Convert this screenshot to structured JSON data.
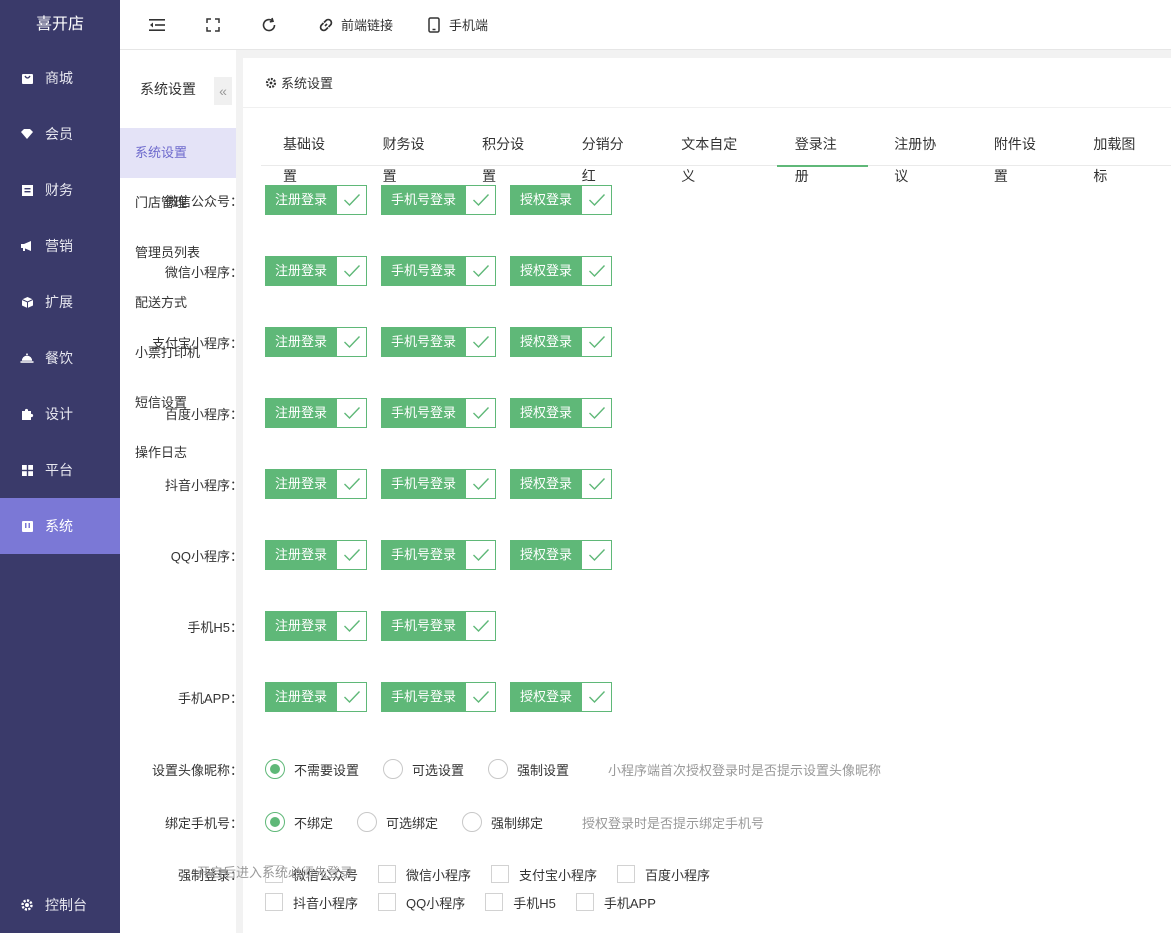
{
  "sidebar": {
    "logo": "喜开店",
    "items": [
      {
        "label": "商城",
        "icon": "shop-icon"
      },
      {
        "label": "会员",
        "icon": "member-icon"
      },
      {
        "label": "财务",
        "icon": "finance-icon"
      },
      {
        "label": "营销",
        "icon": "megaphone-icon"
      },
      {
        "label": "扩展",
        "icon": "cube-icon"
      },
      {
        "label": "餐饮",
        "icon": "dish-icon"
      },
      {
        "label": "设计",
        "icon": "puzzle-icon"
      },
      {
        "label": "平台",
        "icon": "grid-icon"
      },
      {
        "label": "系统",
        "icon": "system-icon"
      }
    ],
    "active_index": 8,
    "bottom": {
      "label": "控制台",
      "icon": "gear-icon"
    }
  },
  "header": {
    "menu_icon": "menu-fold-icon",
    "fullscreen_icon": "fullscreen-icon",
    "refresh_icon": "refresh-icon",
    "frontend_link": "前端链接",
    "mobile": "手机端"
  },
  "subnav": {
    "title": "系统设置",
    "collapse_glyph": "«",
    "items": [
      "系统设置",
      "门店管理",
      "管理员列表",
      "配送方式",
      "小票打印机",
      "短信设置",
      "操作日志"
    ],
    "active_index": 0
  },
  "panel": {
    "title": "系统设置",
    "tabs": [
      "基础设置",
      "财务设置",
      "积分设置",
      "分销分红",
      "文本自定义",
      "登录注册",
      "注册协议",
      "附件设置",
      "加载图标"
    ],
    "active_tab": 5
  },
  "login_rows": [
    {
      "label": "微信公众号：",
      "options": [
        "注册登录",
        "手机号登录",
        "授权登录"
      ]
    },
    {
      "label": "微信小程序：",
      "options": [
        "注册登录",
        "手机号登录",
        "授权登录"
      ]
    },
    {
      "label": "支付宝小程序：",
      "options": [
        "注册登录",
        "手机号登录",
        "授权登录"
      ]
    },
    {
      "label": "百度小程序：",
      "options": [
        "注册登录",
        "手机号登录",
        "授权登录"
      ]
    },
    {
      "label": "抖音小程序：",
      "options": [
        "注册登录",
        "手机号登录",
        "授权登录"
      ]
    },
    {
      "label": "QQ小程序：",
      "options": [
        "注册登录",
        "手机号登录",
        "授权登录"
      ]
    },
    {
      "label": "手机H5：",
      "options": [
        "注册登录",
        "手机号登录"
      ]
    },
    {
      "label": "手机APP：",
      "options": [
        "注册登录",
        "手机号登录",
        "授权登录"
      ]
    }
  ],
  "avatar_setting": {
    "label": "设置头像昵称：",
    "options": [
      "不需要设置",
      "可选设置",
      "强制设置"
    ],
    "selected": 0,
    "tip": "小程序端首次授权登录时是否提示设置头像昵称"
  },
  "bind_phone": {
    "label": "绑定手机号：",
    "options": [
      "不绑定",
      "可选绑定",
      "强制绑定"
    ],
    "selected": 0,
    "tip": "授权登录时是否提示绑定手机号"
  },
  "force_login": {
    "label": "强制登录：",
    "row1": [
      "微信公众号",
      "微信小程序",
      "支付宝小程序",
      "百度小程序"
    ],
    "row2": [
      "抖音小程序",
      "QQ小程序",
      "手机H5",
      "手机APP"
    ],
    "note": "开启后进入系统必须先登录"
  },
  "colors": {
    "sidebar_bg": "#3a3a6a",
    "active_purple": "#7b78d6",
    "green": "#5fb878"
  }
}
